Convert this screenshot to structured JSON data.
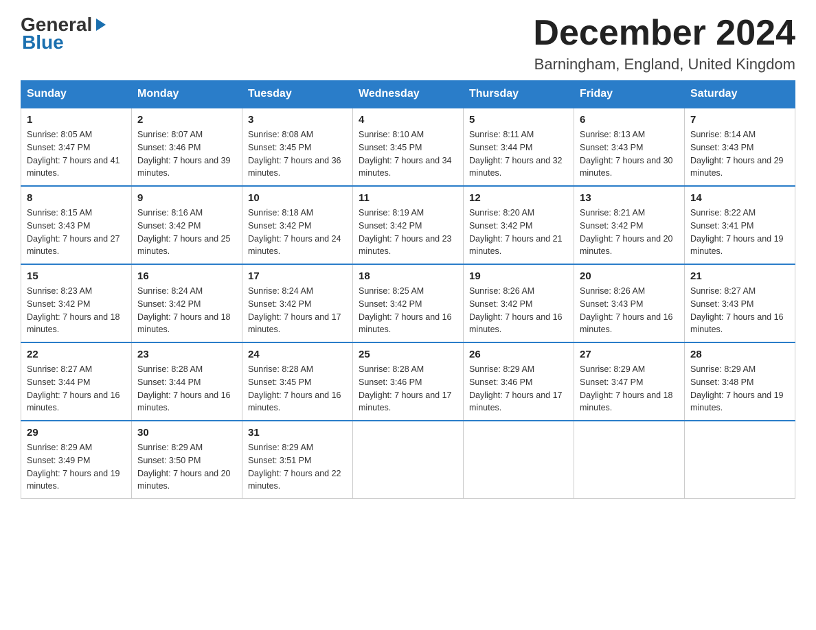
{
  "header": {
    "logo_general": "General",
    "logo_blue": "Blue",
    "month_title": "December 2024",
    "location": "Barningham, England, United Kingdom"
  },
  "weekdays": [
    "Sunday",
    "Monday",
    "Tuesday",
    "Wednesday",
    "Thursday",
    "Friday",
    "Saturday"
  ],
  "weeks": [
    [
      {
        "day": "1",
        "sunrise": "8:05 AM",
        "sunset": "3:47 PM",
        "daylight": "7 hours and 41 minutes."
      },
      {
        "day": "2",
        "sunrise": "8:07 AM",
        "sunset": "3:46 PM",
        "daylight": "7 hours and 39 minutes."
      },
      {
        "day": "3",
        "sunrise": "8:08 AM",
        "sunset": "3:45 PM",
        "daylight": "7 hours and 36 minutes."
      },
      {
        "day": "4",
        "sunrise": "8:10 AM",
        "sunset": "3:45 PM",
        "daylight": "7 hours and 34 minutes."
      },
      {
        "day": "5",
        "sunrise": "8:11 AM",
        "sunset": "3:44 PM",
        "daylight": "7 hours and 32 minutes."
      },
      {
        "day": "6",
        "sunrise": "8:13 AM",
        "sunset": "3:43 PM",
        "daylight": "7 hours and 30 minutes."
      },
      {
        "day": "7",
        "sunrise": "8:14 AM",
        "sunset": "3:43 PM",
        "daylight": "7 hours and 29 minutes."
      }
    ],
    [
      {
        "day": "8",
        "sunrise": "8:15 AM",
        "sunset": "3:43 PM",
        "daylight": "7 hours and 27 minutes."
      },
      {
        "day": "9",
        "sunrise": "8:16 AM",
        "sunset": "3:42 PM",
        "daylight": "7 hours and 25 minutes."
      },
      {
        "day": "10",
        "sunrise": "8:18 AM",
        "sunset": "3:42 PM",
        "daylight": "7 hours and 24 minutes."
      },
      {
        "day": "11",
        "sunrise": "8:19 AM",
        "sunset": "3:42 PM",
        "daylight": "7 hours and 23 minutes."
      },
      {
        "day": "12",
        "sunrise": "8:20 AM",
        "sunset": "3:42 PM",
        "daylight": "7 hours and 21 minutes."
      },
      {
        "day": "13",
        "sunrise": "8:21 AM",
        "sunset": "3:42 PM",
        "daylight": "7 hours and 20 minutes."
      },
      {
        "day": "14",
        "sunrise": "8:22 AM",
        "sunset": "3:41 PM",
        "daylight": "7 hours and 19 minutes."
      }
    ],
    [
      {
        "day": "15",
        "sunrise": "8:23 AM",
        "sunset": "3:42 PM",
        "daylight": "7 hours and 18 minutes."
      },
      {
        "day": "16",
        "sunrise": "8:24 AM",
        "sunset": "3:42 PM",
        "daylight": "7 hours and 18 minutes."
      },
      {
        "day": "17",
        "sunrise": "8:24 AM",
        "sunset": "3:42 PM",
        "daylight": "7 hours and 17 minutes."
      },
      {
        "day": "18",
        "sunrise": "8:25 AM",
        "sunset": "3:42 PM",
        "daylight": "7 hours and 16 minutes."
      },
      {
        "day": "19",
        "sunrise": "8:26 AM",
        "sunset": "3:42 PM",
        "daylight": "7 hours and 16 minutes."
      },
      {
        "day": "20",
        "sunrise": "8:26 AM",
        "sunset": "3:43 PM",
        "daylight": "7 hours and 16 minutes."
      },
      {
        "day": "21",
        "sunrise": "8:27 AM",
        "sunset": "3:43 PM",
        "daylight": "7 hours and 16 minutes."
      }
    ],
    [
      {
        "day": "22",
        "sunrise": "8:27 AM",
        "sunset": "3:44 PM",
        "daylight": "7 hours and 16 minutes."
      },
      {
        "day": "23",
        "sunrise": "8:28 AM",
        "sunset": "3:44 PM",
        "daylight": "7 hours and 16 minutes."
      },
      {
        "day": "24",
        "sunrise": "8:28 AM",
        "sunset": "3:45 PM",
        "daylight": "7 hours and 16 minutes."
      },
      {
        "day": "25",
        "sunrise": "8:28 AM",
        "sunset": "3:46 PM",
        "daylight": "7 hours and 17 minutes."
      },
      {
        "day": "26",
        "sunrise": "8:29 AM",
        "sunset": "3:46 PM",
        "daylight": "7 hours and 17 minutes."
      },
      {
        "day": "27",
        "sunrise": "8:29 AM",
        "sunset": "3:47 PM",
        "daylight": "7 hours and 18 minutes."
      },
      {
        "day": "28",
        "sunrise": "8:29 AM",
        "sunset": "3:48 PM",
        "daylight": "7 hours and 19 minutes."
      }
    ],
    [
      {
        "day": "29",
        "sunrise": "8:29 AM",
        "sunset": "3:49 PM",
        "daylight": "7 hours and 19 minutes."
      },
      {
        "day": "30",
        "sunrise": "8:29 AM",
        "sunset": "3:50 PM",
        "daylight": "7 hours and 20 minutes."
      },
      {
        "day": "31",
        "sunrise": "8:29 AM",
        "sunset": "3:51 PM",
        "daylight": "7 hours and 22 minutes."
      },
      null,
      null,
      null,
      null
    ]
  ]
}
